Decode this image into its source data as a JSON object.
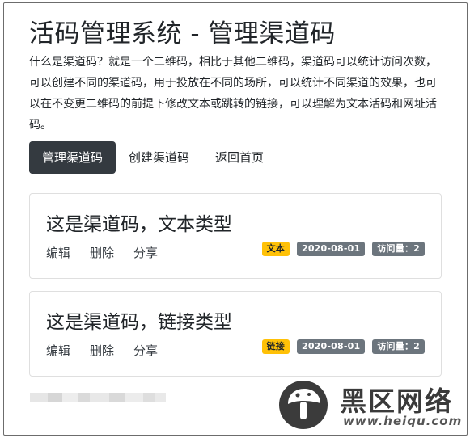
{
  "page": {
    "title": "活码管理系统 - 管理渠道码",
    "description": "什么是渠道码？就是一个二维码，相比于其他二维码，渠道码可以统计访问次数，可以创建不同的渠道码，用于投放在不同的场所，可以统计不同渠道的效果，也可以在不变更二维码的前提下修改文本或跳转的链接，可以理解为文本活码和网址活码。"
  },
  "nav": [
    {
      "label": "管理渠道码",
      "active": true
    },
    {
      "label": "创建渠道码",
      "active": false
    },
    {
      "label": "返回首页",
      "active": false
    }
  ],
  "cards": [
    {
      "title": "这是渠道码，文本类型",
      "actions": {
        "edit": "编辑",
        "delete": "删除",
        "share": "分享"
      },
      "type_badge": "文本",
      "date": "2020-08-01",
      "visits": "访问量：2"
    },
    {
      "title": "这是渠道码，链接类型",
      "actions": {
        "edit": "编辑",
        "delete": "删除",
        "share": "分享"
      },
      "type_badge": "链接",
      "date": "2020-08-01",
      "visits": "访问量：2"
    }
  ],
  "watermark": {
    "name": "黑区网络",
    "url": "www.heiqu.com",
    "icon": "mushroom-logo-icon"
  },
  "colors": {
    "nav_active_bg": "#343a40",
    "badge_type": "#ffc107",
    "badge_gray": "#6c757d"
  }
}
